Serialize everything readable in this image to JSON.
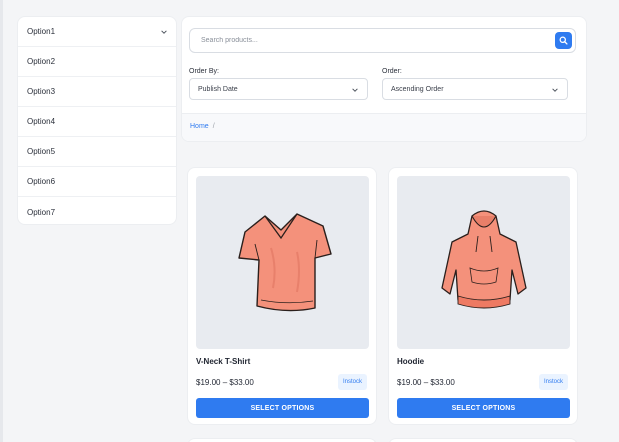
{
  "sidebar": {
    "items": [
      {
        "label": "Option1",
        "icon": "chevron-down-icon"
      },
      {
        "label": "Option2"
      },
      {
        "label": "Option3"
      },
      {
        "label": "Option4"
      },
      {
        "label": "Option5"
      },
      {
        "label": "Option6"
      },
      {
        "label": "Option7"
      }
    ]
  },
  "search": {
    "placeholder": "Search products...",
    "icon": "search-icon"
  },
  "filters": {
    "order_by": {
      "label": "Order By:",
      "selected": "Publish Date"
    },
    "order": {
      "label": "Order:",
      "selected": "Ascending Order"
    }
  },
  "breadcrumb": {
    "home": "Home",
    "separator": "/"
  },
  "products": [
    {
      "name": "V-Neck T-Shirt",
      "price": "$19.00 – $33.00",
      "stock": "Instock",
      "button": "SELECT OPTIONS"
    },
    {
      "name": "Hoodie",
      "price": "$19.00 – $33.00",
      "stock": "Instock",
      "button": "SELECT OPTIONS"
    }
  ],
  "colors": {
    "accent": "#2f7bf0",
    "page_bg": "#f4f5f7",
    "product_image_bg": "#e8ebf0",
    "garment": "#f4917b"
  }
}
